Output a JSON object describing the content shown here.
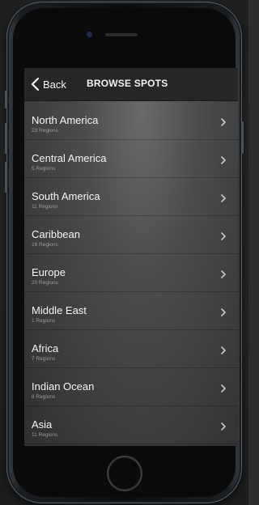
{
  "navbar": {
    "back_label": "Back",
    "title": "BROWSE SPOTS"
  },
  "regions": [
    {
      "name": "North America",
      "count": "23 Regions"
    },
    {
      "name": "Central America",
      "count": "5 Regions"
    },
    {
      "name": "South America",
      "count": "11 Regions"
    },
    {
      "name": "Caribbean",
      "count": "16 Regions"
    },
    {
      "name": "Europe",
      "count": "20 Regions"
    },
    {
      "name": "Middle East",
      "count": "1 Regions"
    },
    {
      "name": "Africa",
      "count": "7 Regions"
    },
    {
      "name": "Indian Ocean",
      "count": "6 Regions"
    },
    {
      "name": "Asia",
      "count": "11 Regions"
    }
  ],
  "icons": {
    "back": "chevron-left-icon",
    "row": "chevron-right-icon"
  },
  "colors": {
    "screen_bg": "#4c4c4c",
    "navbar_bg": "#262626",
    "text": "#f5f5f5",
    "subtext": "#9a9a9a"
  }
}
